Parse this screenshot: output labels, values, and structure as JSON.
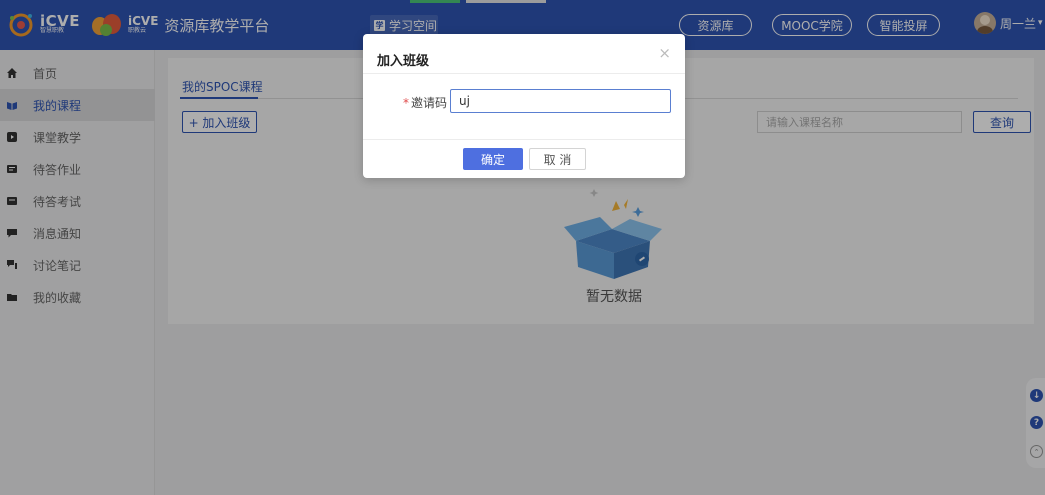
{
  "header": {
    "brand_1": "iCVE",
    "brand_1_sub": "智慧职教",
    "brand_2": "iCVE",
    "brand_2_sub": "职教云",
    "platform_name": "资源库教学平台",
    "study_space": "学习空间",
    "study_space_icon": "学",
    "pills": [
      "资源库",
      "MOOC学院",
      "智能投屏"
    ],
    "user_name": "周一兰"
  },
  "sidebar": {
    "items": [
      {
        "label": "首页",
        "icon": "home-icon"
      },
      {
        "label": "我的课程",
        "icon": "course-icon"
      },
      {
        "label": "课堂教学",
        "icon": "classroom-icon"
      },
      {
        "label": "待答作业",
        "icon": "homework-icon"
      },
      {
        "label": "待答考试",
        "icon": "exam-icon"
      },
      {
        "label": "消息通知",
        "icon": "message-icon"
      },
      {
        "label": "讨论笔记",
        "icon": "discussion-icon"
      },
      {
        "label": "我的收藏",
        "icon": "favorite-icon"
      }
    ],
    "active_index": 1
  },
  "main": {
    "tab": "我的SPOC课程",
    "join_button": "+ 加入班级",
    "search_placeholder": "请输入课程名称",
    "search_button": "查询",
    "empty_text": "暂无数据"
  },
  "modal": {
    "title": "加入班级",
    "close": "×",
    "required_mark": "*",
    "field_label": "邀请码",
    "field_value": "uj",
    "ok": "确定",
    "cancel": "取 消"
  },
  "colors": {
    "brand": "#2f55b3",
    "primary_button": "#4e6fe0",
    "required": "#e04b4b"
  }
}
